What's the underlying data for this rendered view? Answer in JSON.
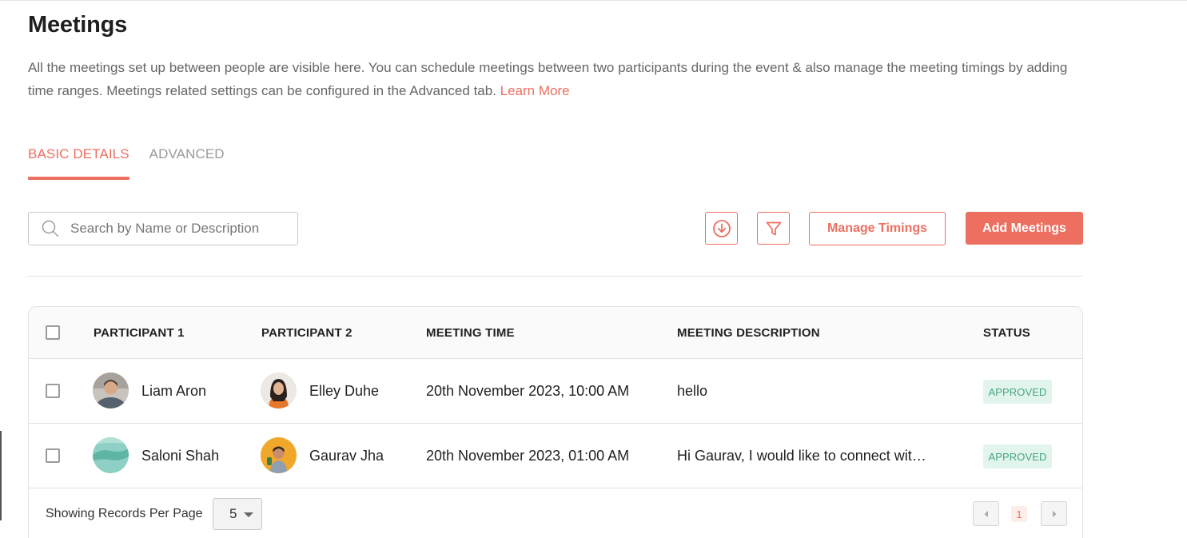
{
  "header": {
    "title": "Meetings",
    "description": "All the meetings set up between people are visible here. You can schedule meetings between two participants during the event & also manage the meeting timings by adding time ranges. Meetings related settings can be configured in the Advanced tab.",
    "learn_more": "Learn More"
  },
  "tabs": [
    {
      "label": "BASIC DETAILS",
      "active": true
    },
    {
      "label": "ADVANCED",
      "active": false
    }
  ],
  "toolbar": {
    "search_placeholder": "Search by Name or Description",
    "download_icon": "download-circle-icon",
    "filter_icon": "filter-icon",
    "manage_timings": "Manage Timings",
    "add_meetings": "Add Meetings"
  },
  "table": {
    "columns": [
      "PARTICIPANT 1",
      "PARTICIPANT 2",
      "MEETING TIME",
      "MEETING DESCRIPTION",
      "STATUS"
    ],
    "rows": [
      {
        "participant1": "Liam Aron",
        "participant2": "Elley Duhe",
        "time": "20th November 2023, 10:00 AM",
        "description": "hello",
        "status": "APPROVED"
      },
      {
        "participant1": "Saloni Shah",
        "participant2": "Gaurav Jha",
        "time": "20th November 2023, 01:00 AM",
        "description": "Hi Gaurav, I would like to connect wit…",
        "status": "APPROVED"
      }
    ]
  },
  "footer": {
    "records_label": "Showing Records Per Page",
    "per_page": "5",
    "current_page": "1"
  },
  "colors": {
    "accent": "#ec6f5f",
    "approved_bg": "#e1f5ec",
    "approved_text": "#47a57e"
  }
}
